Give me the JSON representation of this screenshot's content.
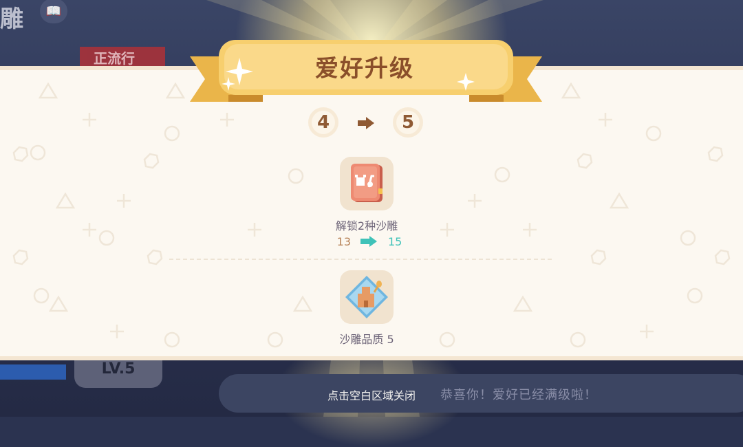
{
  "background": {
    "title_fragment": "雕",
    "badge": "正流行",
    "level_tag": "LV.5",
    "tap_hint": "点击空白区域关闭",
    "congrats": "恭喜你！爱好已经满级啦！"
  },
  "dialog": {
    "title": "爱好升级",
    "level_from": "4",
    "level_to": "5",
    "rewards": [
      {
        "icon": "sand-sculpture-book-icon",
        "label": "解锁2种沙雕",
        "old_value": "13",
        "new_value": "15"
      },
      {
        "icon": "sand-castle-quality-icon",
        "label": "沙雕品质 5"
      }
    ]
  },
  "colors": {
    "ribbon": "#f7cf6e",
    "title_text": "#8a4f2a",
    "new_value": "#3fc2b8",
    "old_value": "#b8845a",
    "panel": "#fcf8f1"
  }
}
